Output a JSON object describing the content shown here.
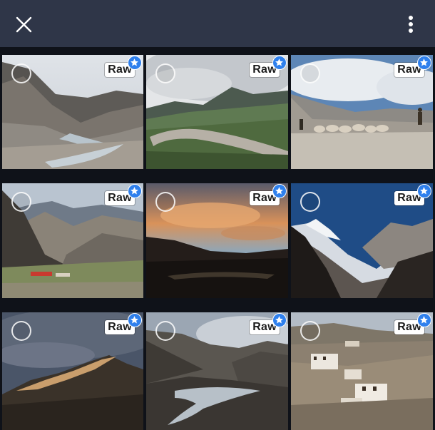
{
  "toolbar": {
    "close_icon": "close-icon",
    "more_icon": "more-vertical-icon"
  },
  "photos": [
    {
      "id_label": "Valley with winding river",
      "badge": "Raw",
      "favorite": true,
      "selected": false
    },
    {
      "id_label": "Road through green hills under clouds",
      "badge": "Raw",
      "favorite": true,
      "selected": false
    },
    {
      "id_label": "Shepherd herding sheep",
      "badge": "Raw",
      "favorite": true,
      "selected": false
    },
    {
      "id_label": "Village below rocky mountains",
      "badge": "Raw",
      "favorite": true,
      "selected": false
    },
    {
      "id_label": "Sunset sky over dark ridge",
      "badge": "Raw",
      "favorite": true,
      "selected": false
    },
    {
      "id_label": "Snow-capped peak in valley",
      "badge": "Raw",
      "favorite": true,
      "selected": false
    },
    {
      "id_label": "Sunlit mountain ridge under stormy sky",
      "badge": "Raw",
      "favorite": true,
      "selected": false
    },
    {
      "id_label": "Braided river valley",
      "badge": "Raw",
      "favorite": true,
      "selected": false
    },
    {
      "id_label": "Monastery on hillside",
      "badge": "Raw",
      "favorite": true,
      "selected": false
    }
  ],
  "colors": {
    "topbar": "#2f3648",
    "background": "#0e1320",
    "favorite_badge": "#2f80ed"
  }
}
